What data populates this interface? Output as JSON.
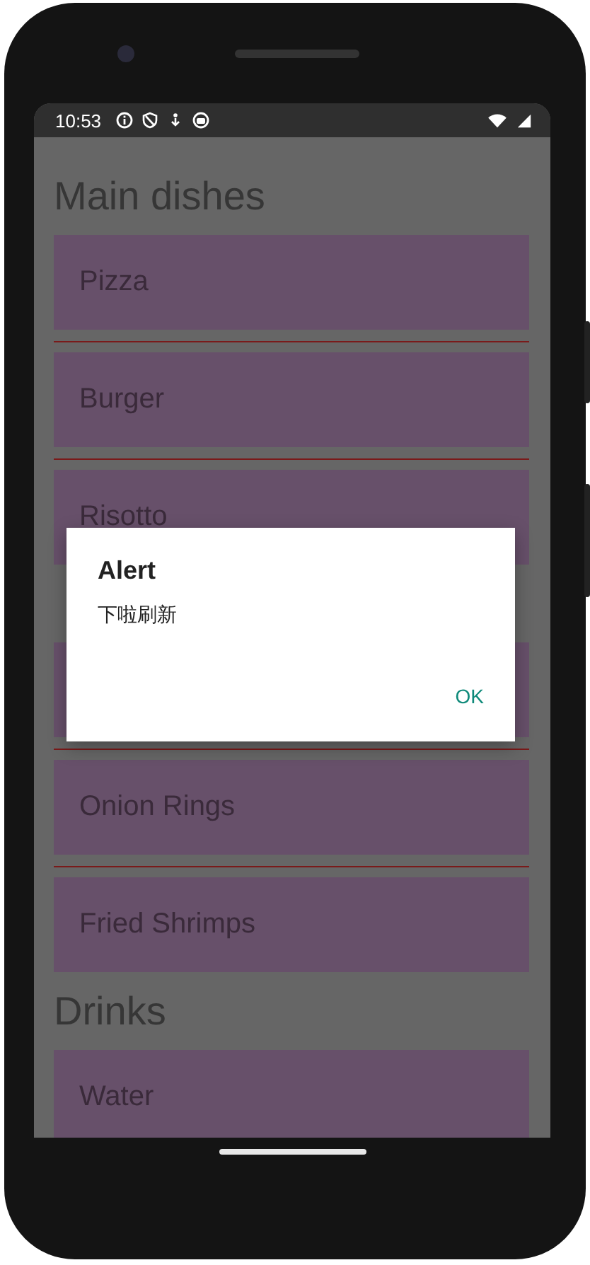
{
  "status_bar": {
    "time": "10:53"
  },
  "sections": [
    {
      "title": "Main dishes",
      "items": [
        {
          "kind": "card",
          "label": "Pizza"
        },
        {
          "kind": "card",
          "label": "Burger"
        },
        {
          "kind": "card",
          "label": "Risotto"
        }
      ]
    },
    {
      "items": [
        {
          "kind": "card"
        },
        {
          "kind": "card",
          "label": "Onion Rings"
        },
        {
          "kind": "card",
          "label": "Fried Shrimps"
        }
      ]
    },
    {
      "title": "Drinks",
      "items": [
        {
          "kind": "card",
          "label": "Water"
        }
      ]
    }
  ],
  "dialog": {
    "title": "Alert",
    "message": "下啦刷新",
    "buttons": [
      "OK"
    ]
  }
}
